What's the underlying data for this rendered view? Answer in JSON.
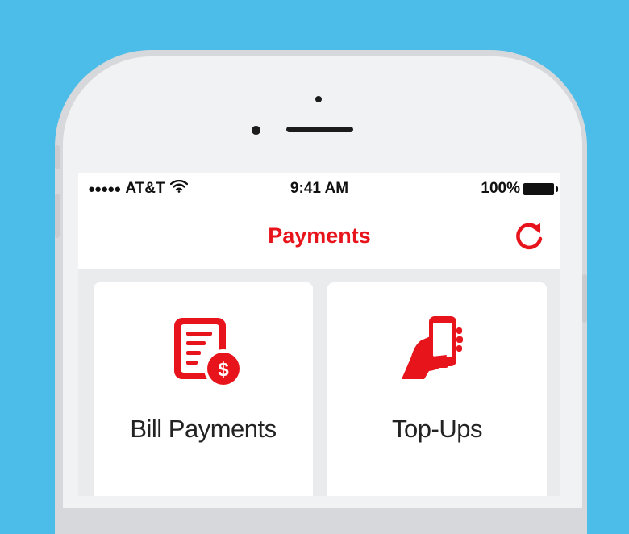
{
  "status_bar": {
    "signal": "●●●●●",
    "carrier": "AT&T",
    "time": "9:41 AM",
    "battery": "100%"
  },
  "header": {
    "title": "Payments",
    "refresh_icon": "refresh-icon"
  },
  "cards": [
    {
      "label": "Bill Payments",
      "icon": "bill-dollar-icon"
    },
    {
      "label": "Top-Ups",
      "icon": "phone-in-hand-icon"
    }
  ],
  "colors": {
    "background": "#4bbde8",
    "accent": "#e8141c"
  }
}
